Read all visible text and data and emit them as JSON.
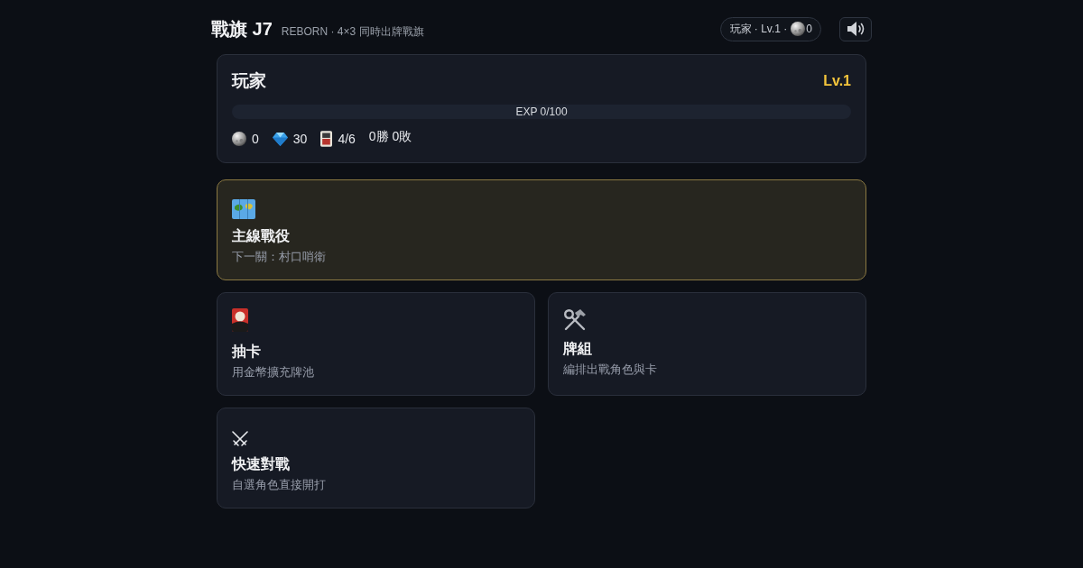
{
  "header": {
    "title": "戰旗 J7",
    "subtitle": "REBORN · 4×3 同時出牌戰旗",
    "player_chip": {
      "label": "玩家 · Lv.1 ·",
      "coins": "0"
    }
  },
  "player": {
    "name": "玩家",
    "level_label": "Lv.1",
    "exp": {
      "label": "EXP 0/100",
      "level": 0
    },
    "stats": [
      {
        "value": "0"
      },
      {
        "value": "30"
      },
      {
        "value": "4/6"
      }
    ],
    "record": "0勝 0敗"
  },
  "modes": [
    {
      "title": "主線戰役",
      "subtitle": "下一關：村口哨衛",
      "featured": true
    },
    {
      "title": "抽卡",
      "subtitle": "用金幣擴充牌池",
      "featured": false
    },
    {
      "title": "牌組",
      "subtitle": "編排出戰角色與卡",
      "featured": false
    },
    {
      "title": "快速對戰",
      "subtitle": "自選角色直接開打",
      "featured": false
    }
  ]
}
